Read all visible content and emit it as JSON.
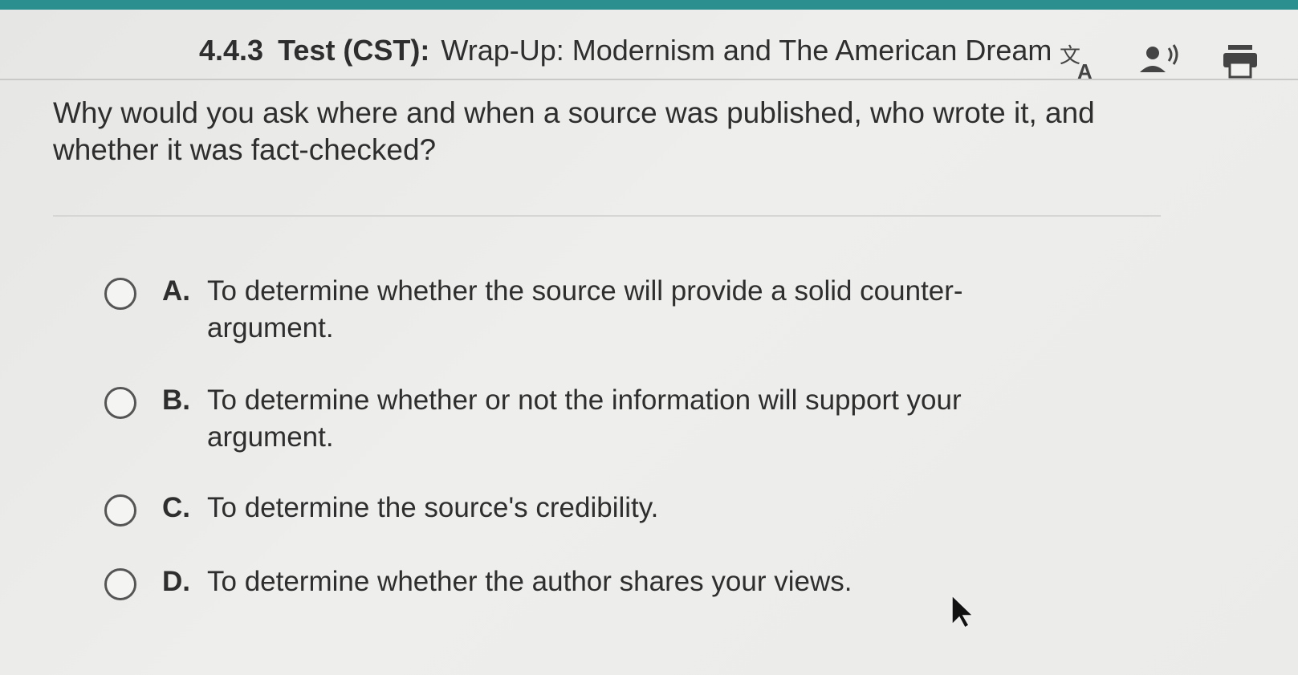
{
  "header": {
    "lesson_number": "4.4.3",
    "lesson_type": "Test (CST):",
    "lesson_title": "Wrap-Up: Modernism and The American Dream",
    "icons": [
      "translate-icon",
      "read-aloud-icon",
      "print-icon"
    ]
  },
  "question": {
    "text": "Why would you ask where and when a source was published, who wrote it, and whether it was fact-checked?"
  },
  "options": [
    {
      "letter": "A.",
      "text": "To determine whether the source will provide a solid counter-argument."
    },
    {
      "letter": "B.",
      "text": "To determine whether or not the information will support your argument."
    },
    {
      "letter": "C.",
      "text": "To determine the source's credibility."
    },
    {
      "letter": "D.",
      "text": "To determine whether the author shares your views."
    }
  ],
  "colors": {
    "accent_strip": "#2b8f8f",
    "text": "#2e2e2e",
    "background": "#ebebe9"
  }
}
